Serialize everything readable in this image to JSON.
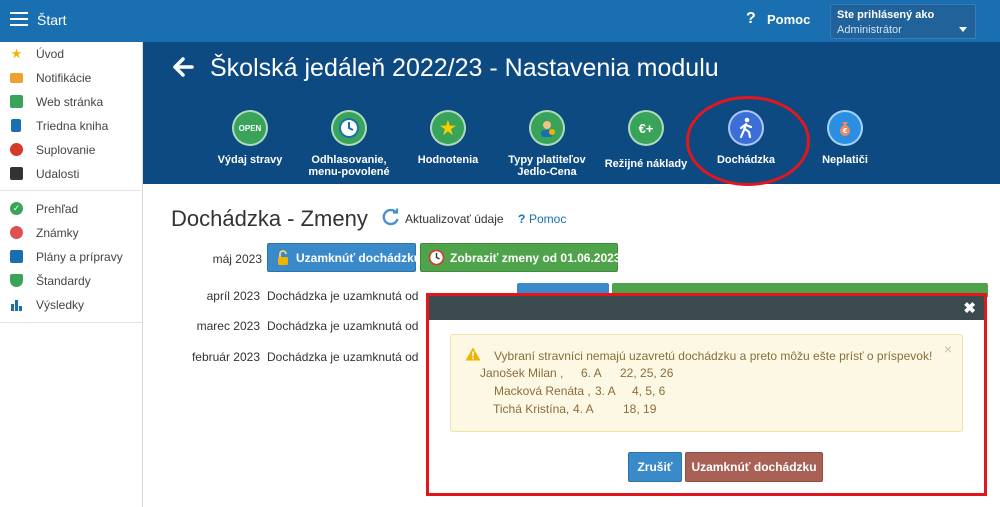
{
  "topbar": {
    "start_label": "Štart",
    "help_label": "Pomoc",
    "user_top": "Ste prihlásený ako",
    "user_role": "Administrátor"
  },
  "sidebar": {
    "items": [
      {
        "label": "Úvod",
        "icon": "star-icon",
        "color": "#f0b400"
      },
      {
        "label": "Notifikácie",
        "icon": "envelope-icon",
        "color": "#f0a030"
      },
      {
        "label": "Web stránka",
        "icon": "home-icon",
        "color": "#3aa35a"
      },
      {
        "label": "Triedna kniha",
        "icon": "book-icon",
        "color": "#1a6fb0"
      },
      {
        "label": "Suplovanie",
        "icon": "person-icon",
        "color": "#d23a2a"
      },
      {
        "label": "Udalosti",
        "icon": "calendar-icon",
        "color": "#333333"
      },
      {
        "label": "Prehľad",
        "icon": "check-circle-icon",
        "color": "#3aa35a"
      },
      {
        "label": "Známky",
        "icon": "grade-icon",
        "color": "#e05050"
      },
      {
        "label": "Plány a prípravy",
        "icon": "briefcase-icon",
        "color": "#1a6fb0"
      },
      {
        "label": "Štandardy",
        "icon": "shield-icon",
        "color": "#3aa35a"
      },
      {
        "label": "Výsledky",
        "icon": "bar-chart-icon",
        "color": "#1a6fb0"
      }
    ]
  },
  "header": {
    "title": "Školská jedáleň 2022/23 - Nastavenia modulu",
    "modules": [
      {
        "line1": "Výdaj stravy",
        "line2": "",
        "icon_text": "OPEN",
        "color": "#3aa35a"
      },
      {
        "line1": "Odhlasovanie,",
        "line2": "menu-povolené",
        "icon_text": "◷",
        "color": "#3aa35a"
      },
      {
        "line1": "Hodnotenia",
        "line2": "",
        "icon_text": "★",
        "color": "#3aa35a"
      },
      {
        "line1": "Typy platiteľov",
        "line2": "Jedlo-Cena",
        "icon_text": "$",
        "color": "#3aa35a"
      },
      {
        "line1": "Režijné náklady",
        "line2": "",
        "icon_text": "€+",
        "color": "#3aa35a"
      },
      {
        "line1": "Dochádzka",
        "line2": "",
        "icon_text": "🚶",
        "color": "#3a6fd8"
      },
      {
        "line1": "Neplatiči",
        "line2": "",
        "icon_text": "€",
        "color": "#2a8fe0"
      }
    ]
  },
  "content": {
    "section_title": "Dochádzka - Zmeny",
    "refresh_label": "Aktualizovať údaje",
    "help_q": "?",
    "help_label": "Pomoc",
    "rows": [
      {
        "month": "máj 2023",
        "text": ""
      },
      {
        "month": "apríl 2023",
        "text": "Dochádzka je uzamknutá od"
      },
      {
        "month": "marec 2023",
        "text": "Dochádzka je uzamknutá od"
      },
      {
        "month": "február 2023",
        "text": "Dochádzka je uzamknutá od"
      }
    ],
    "lock_button": "Uzamknúť dochádzku",
    "shifts_button": "Zobraziť zmeny od 01.06.2023"
  },
  "modal": {
    "close": "✖",
    "alert_message": "Vybraní stravníci nemajú uzavretú dochádzku a preto môžu ešte prísť o príspevok!",
    "alert_close": "×",
    "entries": [
      {
        "name": "Janošek Milan ,",
        "class": "6. A",
        "days": "22, 25, 26"
      },
      {
        "name": "Macková Renáta ,",
        "class": "3. A",
        "days": "4, 5, 6"
      },
      {
        "name": "Tichá Kristína,",
        "class": "4. A",
        "days": "18, 19"
      }
    ],
    "cancel": "Zrušiť",
    "confirm": "Uzamknúť dochádzku"
  },
  "colors": {
    "topbar": "#1a6fb0",
    "band": "#0d4a82",
    "highlight": "#e3161e",
    "primary": "#3a8ac9",
    "success": "#4fa34a",
    "danger": "#a96155"
  }
}
